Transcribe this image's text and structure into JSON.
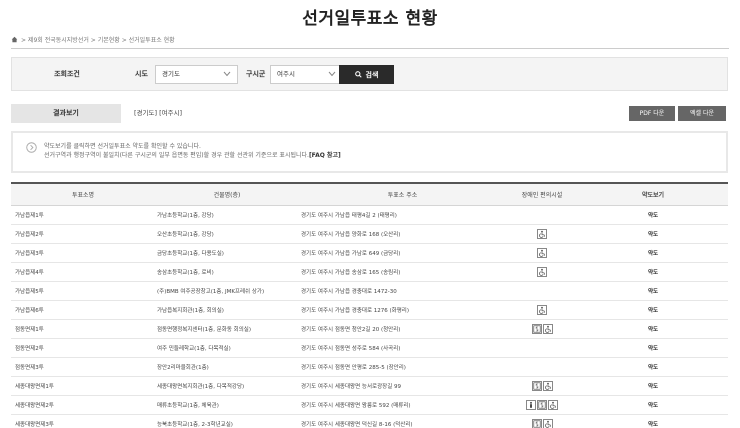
{
  "page": {
    "title": "선거일투표소 현황"
  },
  "breadcrumb": {
    "items": "> 제9회 전국동시지방선거 > 기본현황 > 선거일투표소 현황"
  },
  "search": {
    "label": "조회조건",
    "sido_label": "시도",
    "sido_value": "경기도",
    "sigungu_label": "구시군",
    "sigungu_value": "여주시",
    "button_label": "검색"
  },
  "results": {
    "label": "결과보기",
    "condition": "[경기도] [여주시]",
    "pdf_label": "PDF 다운",
    "excel_label": "엑셀 다운"
  },
  "notice": {
    "line1": "약도보기를 클릭하면 선거일투표소 약도를 확인할 수 있습니다.",
    "line2": "선거구역과 행정구역이 불일치(다른 구시군의 일부 읍면동 편입)할 경우 관할 선관위 기준으로 표시됩니다.",
    "faq": "[FAQ 참고]"
  },
  "table": {
    "headers": [
      "투표소명",
      "건물명(층)",
      "투표소 주소",
      "장애인 편의시설",
      "약도보기"
    ],
    "rows": [
      {
        "name": "가남읍제1투",
        "building": "가남초등학교(1층, 강당)",
        "address": "경기도 여주시 가남읍 태평4길 2 (태평리)",
        "facilities": [],
        "map": "약도"
      },
      {
        "name": "가남읍제2투",
        "building": "오산초등학교(1층, 강당)",
        "address": "경기도 여주시 가남읍 양화로 168 (오산리)",
        "facilities": [
          "wheelchair"
        ],
        "map": "약도"
      },
      {
        "name": "가남읍제3투",
        "building": "금당초등학교(1층, 다용도실)",
        "address": "경기도 여주시 가남읍 가남로 649 (금당리)",
        "facilities": [
          "wheelchair"
        ],
        "map": "약도"
      },
      {
        "name": "가남읍제4투",
        "building": "송삼초등학교(1층, 로비)",
        "address": "경기도 여주시 가남읍 송삼로 165 (송림리)",
        "facilities": [
          "wheelchair"
        ],
        "map": "약도"
      },
      {
        "name": "가남읍제5투",
        "building": "(주)BMB 여주공장창고(1층, JMK프레쉬 상가)",
        "address": "경기도 여주시 가남읍 경충대로 1472-30",
        "facilities": [],
        "map": "약도"
      },
      {
        "name": "가남읍제6투",
        "building": "가남읍복지회관(1층, 회의실)",
        "address": "경기도 여주시 가남읍 경충대로 1276 (화평리)",
        "facilities": [
          "wheelchair"
        ],
        "map": "약도"
      },
      {
        "name": "점동면제1투",
        "building": "점동면행정복지센터(1층, 문화동 회의실)",
        "address": "경기도 여주시 점동면 청안2길 20 (청안리)",
        "facilities": [
          "elevator",
          "wheelchair"
        ],
        "map": "약도"
      },
      {
        "name": "점동면제2투",
        "building": "여주 민들레학교(1층, 다목적실)",
        "address": "경기도 여주시 점동면 성주로 584 (사곡리)",
        "facilities": [],
        "map": "약도"
      },
      {
        "name": "점동면제3투",
        "building": "장안2리마을회관(1층)",
        "address": "경기도 여주시 점동면 안평로 285-5 (장안리)",
        "facilities": [],
        "map": "약도"
      },
      {
        "name": "세종대왕면제1투",
        "building": "세종대왕면복지회관(1층, 다목적강당)",
        "address": "경기도 여주시 세종대왕면 능서로광장길 99",
        "facilities": [
          "elevator",
          "wheelchair"
        ],
        "map": "약도"
      },
      {
        "name": "세종대왕면제2투",
        "building": "매류초등학교(1층, 체육관)",
        "address": "경기도 여주시 세종대왕면 왕릉로 592 (매류리)",
        "facilities": [
          "person",
          "elevator",
          "wheelchair"
        ],
        "map": "약도"
      },
      {
        "name": "세종대왕면제3투",
        "building": "능북초등학교(1층, 2-3학년교실)",
        "address": "경기도 여주시 세종대왕면 덕신길 8-16 (덕산리)",
        "facilities": [
          "elevator",
          "wheelchair"
        ],
        "map": "약도"
      }
    ]
  }
}
